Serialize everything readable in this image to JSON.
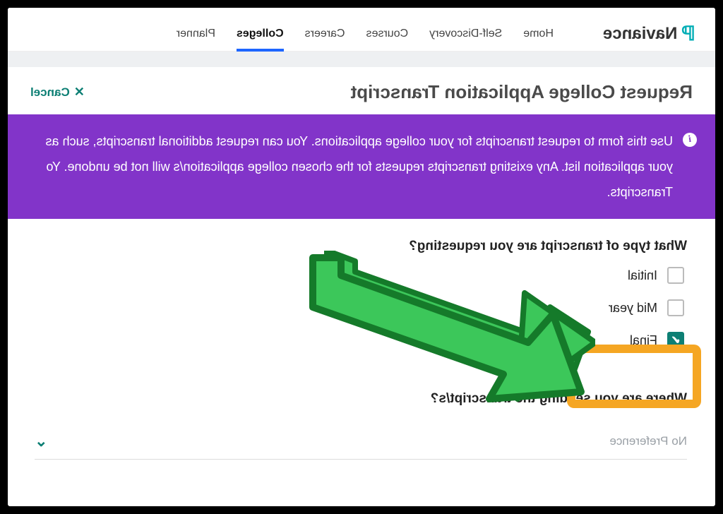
{
  "brand": "Naviance",
  "nav": {
    "items": [
      "Home",
      "Self-Discovery",
      "Courses",
      "Careers",
      "Colleges",
      "Planner"
    ],
    "active_index": 4
  },
  "page": {
    "title": "Request College Application Transcript",
    "cancel": "Cancel"
  },
  "banner": {
    "text": "Use this form to request transcripts for your college applications. You can request additional transcripts, such as your application list. Any existing transcripts requests for the chosen college application/s will not be undone. Yo Transcripts."
  },
  "form": {
    "q1": "What type of transcript are you requesting?",
    "options": [
      {
        "label": "Initial",
        "checked": false
      },
      {
        "label": "Mid year",
        "checked": false
      },
      {
        "label": "Final",
        "checked": true
      }
    ],
    "q2": "Where are you sending the transcript/s?",
    "destination_placeholder": "No Preference"
  }
}
